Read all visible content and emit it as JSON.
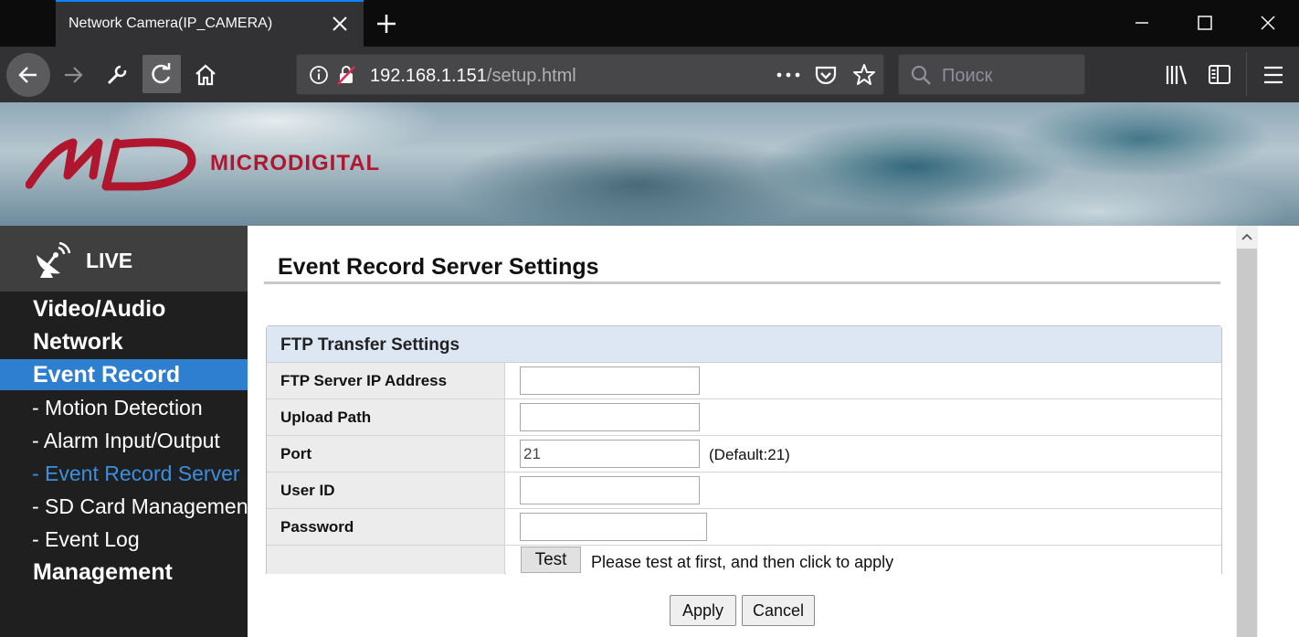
{
  "browser": {
    "tab_title": "Network Camera(IP_CAMERA)",
    "url_host": "192.168.1.151",
    "url_path": "/setup.html",
    "search_placeholder": "Поиск",
    "accent_color": "#0a84ff"
  },
  "banner": {
    "brand": "MICRODIGITAL",
    "logo_mark": "MD",
    "brand_color": "#b0172e"
  },
  "sidebar": {
    "live_label": "LIVE",
    "items": [
      {
        "label": "Video/Audio",
        "level": "main"
      },
      {
        "label": "Network",
        "level": "main"
      },
      {
        "label": "Event Record",
        "level": "main",
        "state": "active"
      },
      {
        "label": "- Motion Detection",
        "level": "sub"
      },
      {
        "label": "- Alarm Input/Output",
        "level": "sub"
      },
      {
        "label": "- Event Record Server",
        "level": "sub",
        "state": "current"
      },
      {
        "label": "- SD Card Management",
        "level": "sub"
      },
      {
        "label": "- Event Log",
        "level": "sub"
      },
      {
        "label": "Management",
        "level": "main"
      }
    ],
    "active_color": "#2e7fcf"
  },
  "main": {
    "page_title": "Event Record Server Settings",
    "panel_title": "FTP Transfer Settings",
    "fields": {
      "ftp_ip": {
        "label": "FTP Server IP Address",
        "value": ""
      },
      "upload_path": {
        "label": "Upload Path",
        "value": ""
      },
      "port": {
        "label": "Port",
        "value": "21",
        "hint": "(Default:21)"
      },
      "user_id": {
        "label": "User ID",
        "value": ""
      },
      "password": {
        "label": "Password",
        "value": ""
      }
    },
    "test_button": "Test",
    "test_hint": "Please test at first, and then click to apply",
    "apply_button": "Apply",
    "cancel_button": "Cancel"
  }
}
